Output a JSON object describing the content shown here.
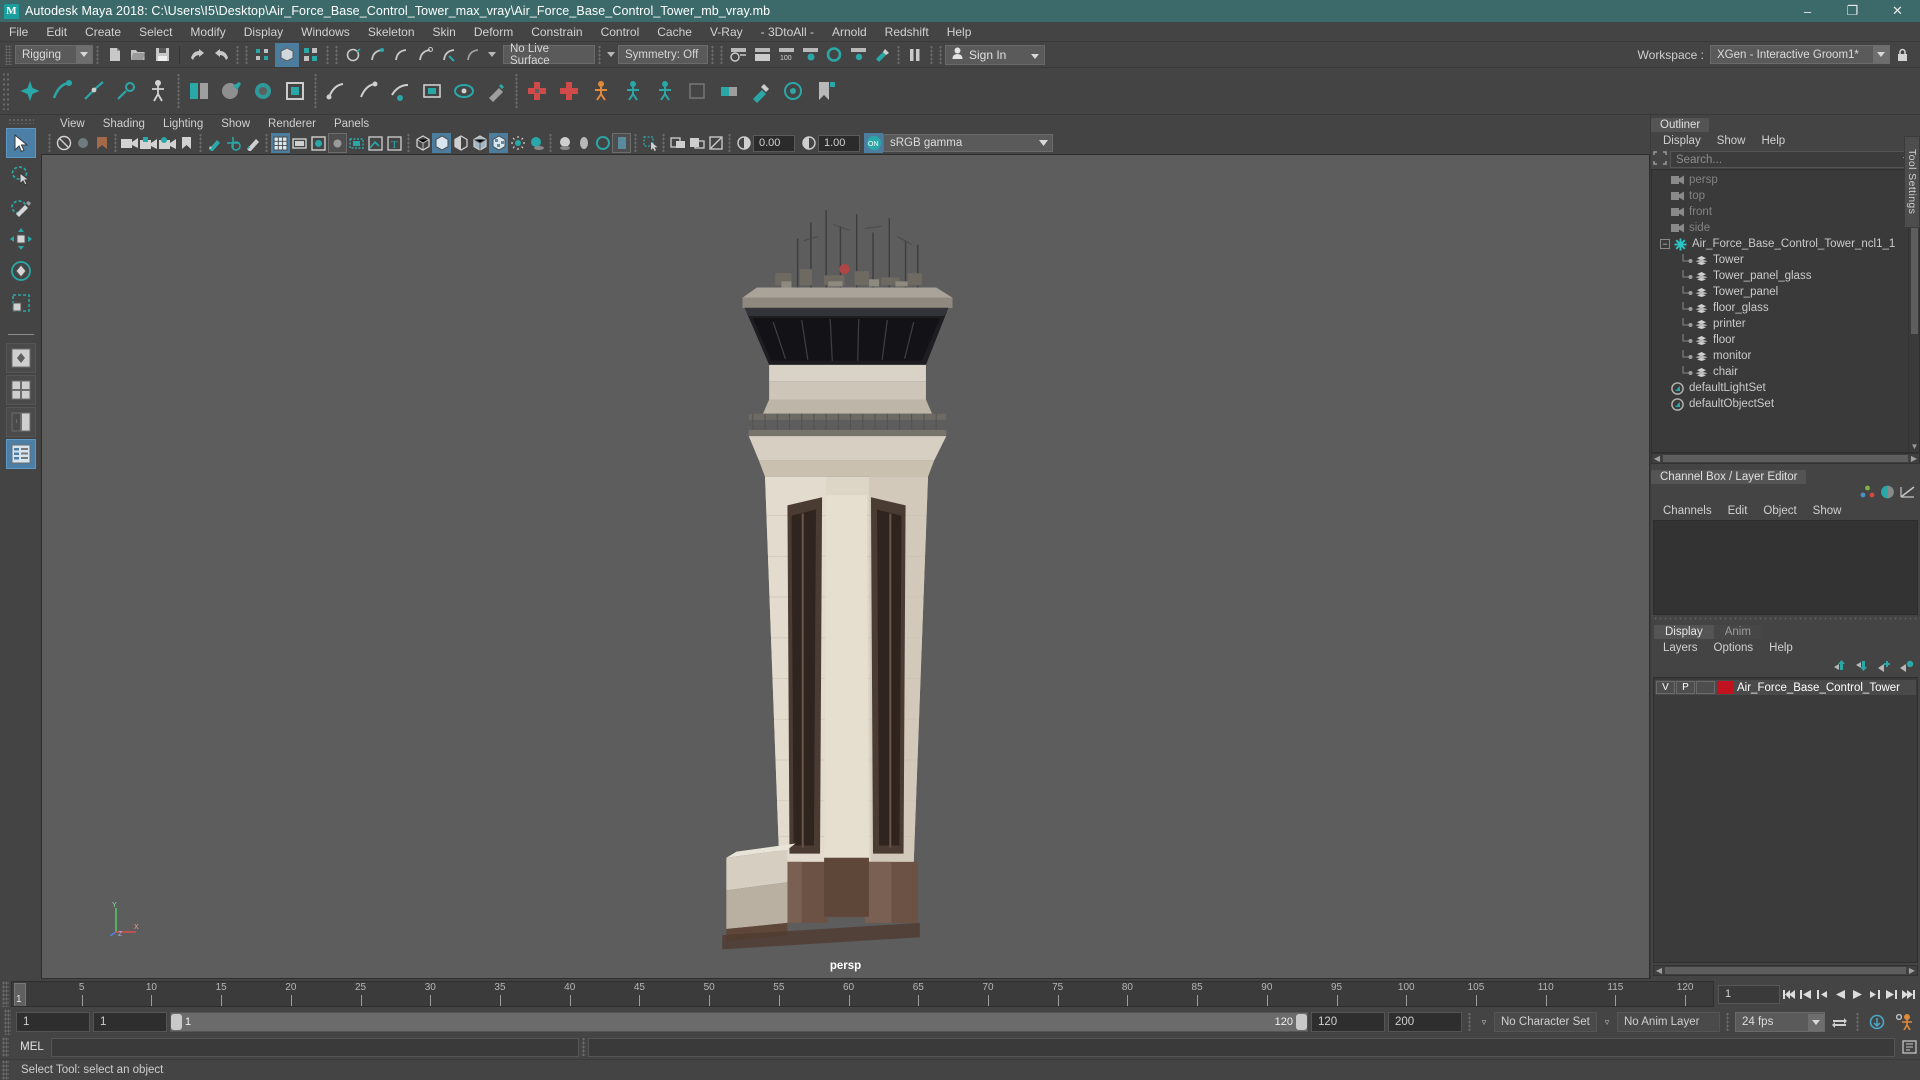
{
  "titlebar": {
    "logo": "M",
    "title": "Autodesk Maya 2018: C:\\Users\\I5\\Desktop\\Air_Force_Base_Control_Tower_max_vray\\Air_Force_Base_Control_Tower_mb_vray.mb",
    "minimize": "–",
    "maximize": "❐",
    "close": "✕"
  },
  "menubar": {
    "items": [
      "File",
      "Edit",
      "Create",
      "Select",
      "Modify",
      "Display",
      "Windows",
      "Skeleton",
      "Skin",
      "Deform",
      "Constrain",
      "Control",
      "Cache",
      "V-Ray",
      "- 3DtoAll -",
      "Arnold",
      "Redshift",
      "Help"
    ]
  },
  "statusline": {
    "menuset": "Rigging",
    "live_surface": "No Live Surface",
    "symmetry": "Symmetry: Off",
    "sign_in": "Sign In",
    "workspace_label": "Workspace :",
    "workspace_value": "XGen - Interactive Groom1*"
  },
  "viewport_panel": {
    "menus": [
      "View",
      "Shading",
      "Lighting",
      "Show",
      "Renderer",
      "Panels"
    ],
    "exposure": "0.00",
    "gamma": "1.00",
    "color_space": "sRGB gamma",
    "camera_label": "persp",
    "axis": {
      "y": "Y",
      "x": "X",
      "z": "Z"
    }
  },
  "outliner": {
    "tab": "Outliner",
    "menus": [
      "Display",
      "Show",
      "Help"
    ],
    "search_placeholder": "Search...",
    "items": [
      {
        "label": "persp",
        "icon": "camera-icon",
        "indent": 1,
        "dim": true,
        "type": "camera"
      },
      {
        "label": "top",
        "icon": "camera-icon",
        "indent": 1,
        "dim": true,
        "type": "camera"
      },
      {
        "label": "front",
        "icon": "camera-icon",
        "indent": 1,
        "dim": true,
        "type": "camera"
      },
      {
        "label": "side",
        "icon": "camera-icon",
        "indent": 1,
        "dim": true,
        "type": "camera"
      },
      {
        "label": "Air_Force_Base_Control_Tower_ncl1_1",
        "icon": "asterisk-icon",
        "indent": 0,
        "dim": false,
        "type": "group",
        "expanded": true
      },
      {
        "label": "Tower",
        "icon": "mesh-icon",
        "indent": 2,
        "dim": false,
        "type": "mesh"
      },
      {
        "label": "Tower_panel_glass",
        "icon": "mesh-icon",
        "indent": 2,
        "dim": false,
        "type": "mesh"
      },
      {
        "label": "Tower_panel",
        "icon": "mesh-icon",
        "indent": 2,
        "dim": false,
        "type": "mesh"
      },
      {
        "label": "floor_glass",
        "icon": "mesh-icon",
        "indent": 2,
        "dim": false,
        "type": "mesh"
      },
      {
        "label": "printer",
        "icon": "mesh-icon",
        "indent": 2,
        "dim": false,
        "type": "mesh"
      },
      {
        "label": "floor",
        "icon": "mesh-icon",
        "indent": 2,
        "dim": false,
        "type": "mesh"
      },
      {
        "label": "monitor",
        "icon": "mesh-icon",
        "indent": 2,
        "dim": false,
        "type": "mesh"
      },
      {
        "label": "chair",
        "icon": "mesh-icon",
        "indent": 2,
        "dim": false,
        "type": "mesh"
      },
      {
        "label": "defaultLightSet",
        "icon": "set-icon",
        "indent": 1,
        "dim": false,
        "type": "set"
      },
      {
        "label": "defaultObjectSet",
        "icon": "set-icon",
        "indent": 1,
        "dim": false,
        "type": "set"
      }
    ]
  },
  "channelbox": {
    "tab": "Channel Box / Layer Editor",
    "menus": [
      "Channels",
      "Edit",
      "Object",
      "Show"
    ]
  },
  "layereditor": {
    "tabs": [
      {
        "label": "Display",
        "selected": true
      },
      {
        "label": "Anim",
        "selected": false
      }
    ],
    "menus": [
      "Layers",
      "Options",
      "Help"
    ],
    "rows": [
      {
        "visible": "V",
        "playback": "P",
        "shading": "",
        "color": "#c1121f",
        "name": "Air_Force_Base_Control_Tower"
      }
    ]
  },
  "timeline": {
    "ticks": [
      {
        "value": "5",
        "pos": 5
      },
      {
        "value": "10",
        "pos": 10
      },
      {
        "value": "15",
        "pos": 15
      },
      {
        "value": "20",
        "pos": 20
      },
      {
        "value": "25",
        "pos": 25
      },
      {
        "value": "30",
        "pos": 30
      },
      {
        "value": "35",
        "pos": 35
      },
      {
        "value": "40",
        "pos": 40
      },
      {
        "value": "45",
        "pos": 45
      },
      {
        "value": "50",
        "pos": 50
      },
      {
        "value": "55",
        "pos": 55
      },
      {
        "value": "60",
        "pos": 60
      },
      {
        "value": "65",
        "pos": 65
      },
      {
        "value": "70",
        "pos": 70
      },
      {
        "value": "75",
        "pos": 75
      },
      {
        "value": "80",
        "pos": 80
      },
      {
        "value": "85",
        "pos": 85
      },
      {
        "value": "90",
        "pos": 90
      },
      {
        "value": "95",
        "pos": 95
      },
      {
        "value": "100",
        "pos": 100
      },
      {
        "value": "105",
        "pos": 105
      },
      {
        "value": "110",
        "pos": 110
      },
      {
        "value": "115",
        "pos": 115
      },
      {
        "value": "120",
        "pos": 120
      }
    ],
    "current_frame": "1",
    "frame_field": "1"
  },
  "rangeslider": {
    "start_field": "1",
    "current_field": "1",
    "range_min": "1",
    "range_max": "120",
    "anim_end": "120",
    "playback_end": "200",
    "character_set": "No Character Set",
    "anim_layer": "No Anim Layer",
    "fps": "24 fps"
  },
  "commandline": {
    "language": "MEL",
    "input_value": ""
  },
  "helpline": {
    "text": "Select Tool: select an object"
  },
  "toolsettings": {
    "label": "Tool Settings"
  },
  "colors": {
    "titlebar": "#3c6a6a",
    "accent_teal": "#2aa8a8",
    "selection_blue": "#4b7fa6",
    "viewport_bg": "#5d5d5d",
    "layer_color": "#c1121f",
    "panel_bg": "#444444"
  }
}
